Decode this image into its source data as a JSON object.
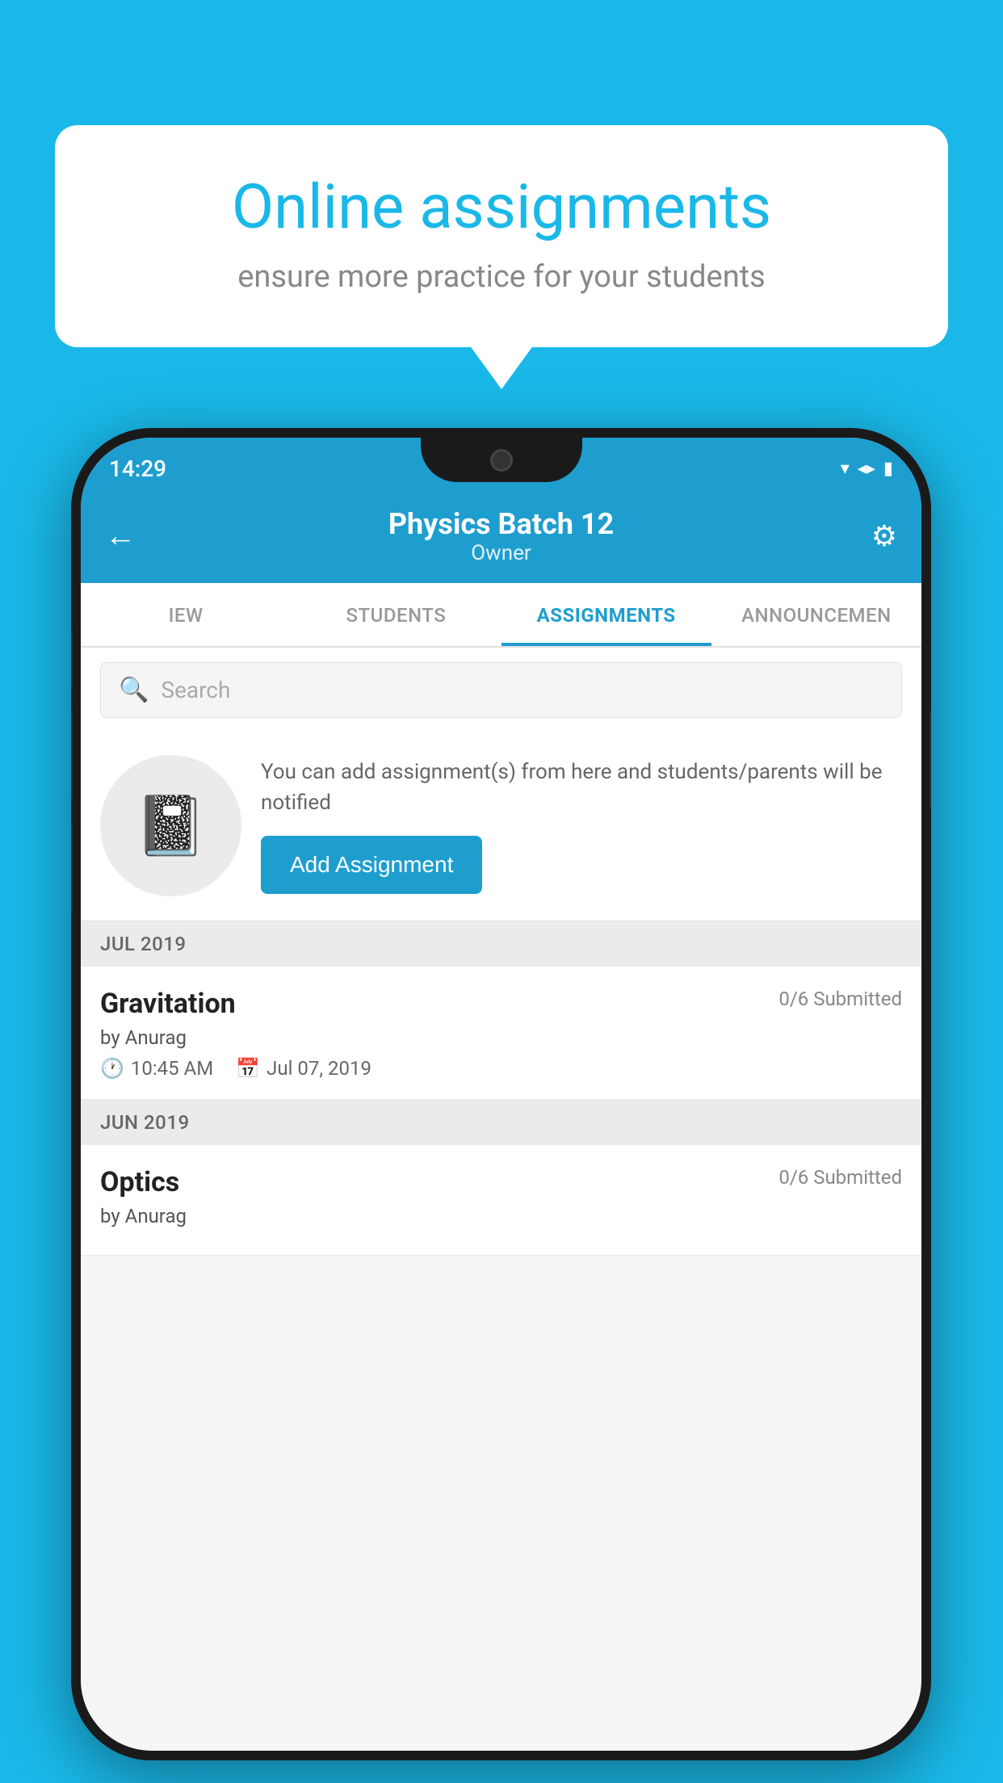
{
  "background_color": "#1ab8e8",
  "speech_bubble": {
    "title": "Online assignments",
    "subtitle": "ensure more practice for your students"
  },
  "phone": {
    "status_bar": {
      "time": "14:29",
      "wifi": "▼",
      "signal": "▲",
      "battery": "▮"
    },
    "header": {
      "title": "Physics Batch 12",
      "subtitle": "Owner",
      "back_label": "←",
      "gear_label": "⚙"
    },
    "tabs": [
      {
        "label": "IEW",
        "active": false
      },
      {
        "label": "STUDENTS",
        "active": false
      },
      {
        "label": "ASSIGNMENTS",
        "active": true
      },
      {
        "label": "ANNOUNCEM...",
        "active": false
      }
    ],
    "search": {
      "placeholder": "Search"
    },
    "promo": {
      "description": "You can add assignment(s) from here and students/parents will be notified",
      "button_label": "Add Assignment"
    },
    "sections": [
      {
        "month": "JUL 2019",
        "assignments": [
          {
            "name": "Gravitation",
            "submitted": "0/6 Submitted",
            "by": "by Anurag",
            "time": "10:45 AM",
            "date": "Jul 07, 2019"
          }
        ]
      },
      {
        "month": "JUN 2019",
        "assignments": [
          {
            "name": "Optics",
            "submitted": "0/6 Submitted",
            "by": "by Anurag",
            "time": "",
            "date": ""
          }
        ]
      }
    ]
  }
}
